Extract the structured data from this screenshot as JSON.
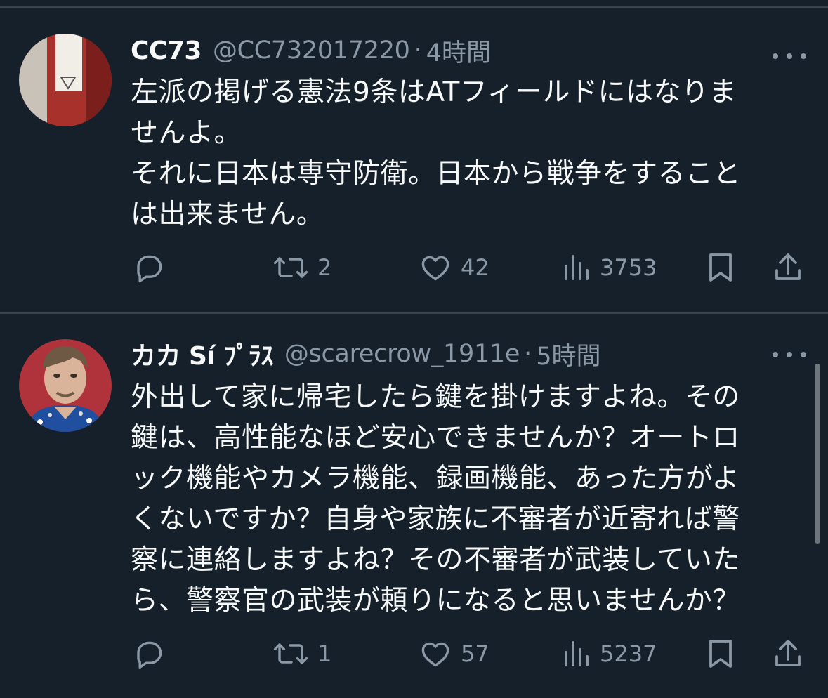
{
  "theme": {
    "background": "#15202b",
    "text": "#f7f9f9",
    "secondary": "#8b98a5",
    "divider": "#38444d"
  },
  "tweets": [
    {
      "author": {
        "name": "CC73",
        "handle": "@CC732017220",
        "avatar_icon": "avatar-red-tag"
      },
      "separator": "·",
      "time": "4時間",
      "lines": [
        "左派の掲げる憲法9条はATフィールドにはなりま",
        "せんよ。",
        "それに日本は専守防衛。日本から戦争をすること",
        "は出来ません。"
      ],
      "metrics": {
        "replies": "",
        "retweets": "2",
        "likes": "42",
        "views": "3753"
      }
    },
    {
      "author": {
        "name": "カカ Sí ﾌﾟﾗｽ",
        "handle": "@scarecrow_1911e",
        "avatar_icon": "avatar-man-portrait"
      },
      "separator": "·",
      "time": "5時間",
      "lines": [
        "外出して家に帰宅したら鍵を掛けますよね。その",
        "鍵は、高性能なほど安心できませんか？オートロ",
        "ック機能やカメラ機能、録画機能、あった方がよ",
        "くないですか？自身や家族に不審者が近寄れば警",
        "察に連絡しますよね？その不審者が武装していた",
        "ら、警察官の武装が頼りになると思いませんか？"
      ],
      "metrics": {
        "replies": "",
        "retweets": "1",
        "likes": "57",
        "views": "5237"
      }
    }
  ]
}
